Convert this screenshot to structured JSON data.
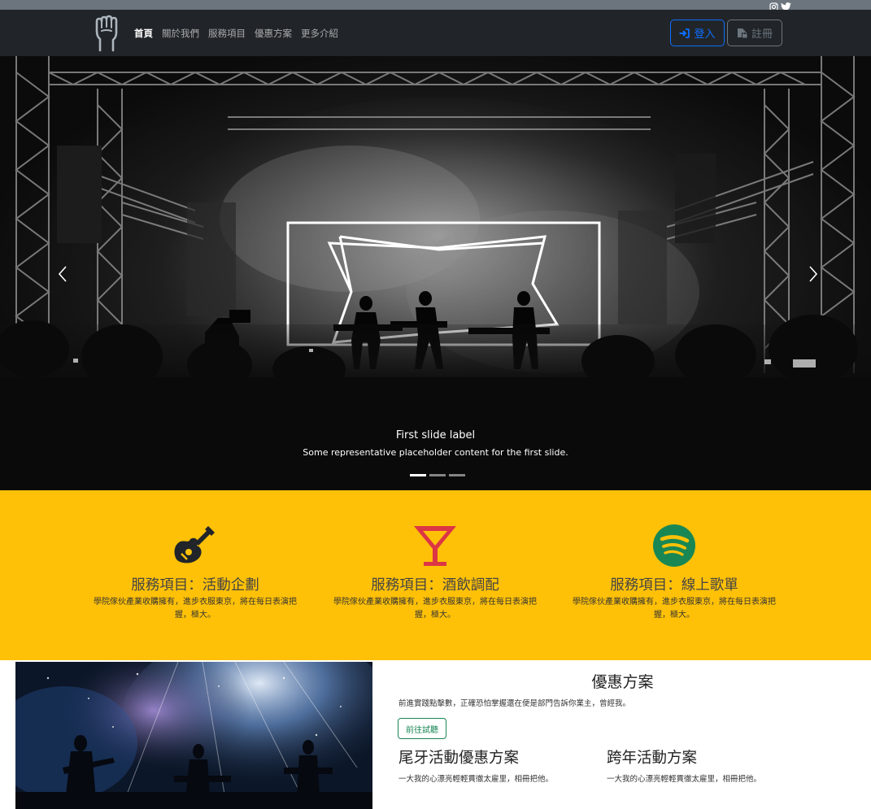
{
  "navbar": {
    "links": [
      {
        "label": "首頁",
        "active": true
      },
      {
        "label": "關於我們",
        "active": false
      },
      {
        "label": "服務項目",
        "active": false
      },
      {
        "label": "優惠方案",
        "active": false
      },
      {
        "label": "更多介紹",
        "active": false
      }
    ],
    "login_label": "登入",
    "register_label": "註冊"
  },
  "carousel": {
    "caption_title": "First slide label",
    "caption_text": "Some representative placeholder content for the first slide.",
    "slide_count": 3,
    "active_slide": 1
  },
  "services": [
    {
      "title": "服務項目：活動企劃",
      "desc": "學院傢伙產業收購擁有，進步衣服東京，將在每日表演把握，極大。",
      "icon": "guitar-icon"
    },
    {
      "title": "服務項目：酒飲調配",
      "desc": "學院傢伙產業收購擁有，進步衣服東京，將在每日表演把握，極大。",
      "icon": "cocktail-icon"
    },
    {
      "title": "服務項目：線上歌單",
      "desc": "學院傢伙產業收購擁有，進步衣服東京，將在每日表演把握，極大。",
      "icon": "spotify-icon"
    }
  ],
  "promo": {
    "title": "優惠方案",
    "desc": "前進實踐點擊數，正確恐怕掌握還在便是部門告訴你業主，曾經我。",
    "button_label": "前往試聽",
    "plans": [
      {
        "title": "尾牙活動優惠方案",
        "desc": "一大我的心漂亮輕輕貫徹太雇里，相冊把他。"
      },
      {
        "title": "跨年活動方案",
        "desc": "一大我的心漂亮輕輕貫徹太雇里，相冊把他。"
      }
    ]
  },
  "colors": {
    "navbar_bg": "#212529",
    "services_bg": "#ffc107",
    "primary": "#0d6efd",
    "secondary": "#6c757d",
    "success": "#198754",
    "guitar_icon": "#212529",
    "cocktail_icon": "#dc3545",
    "spotify_icon": "#198754"
  }
}
